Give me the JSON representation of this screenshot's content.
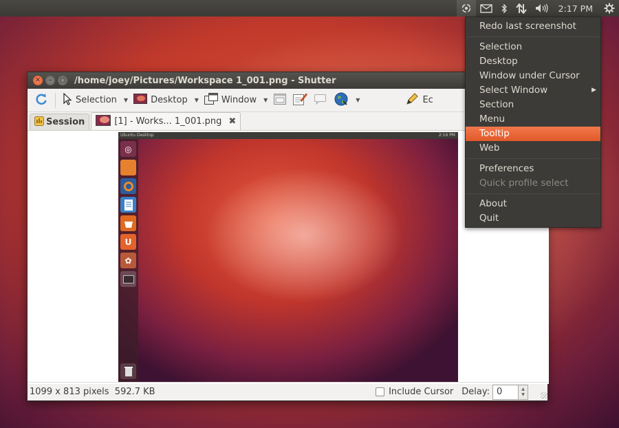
{
  "panel": {
    "clock": "2:17 PM",
    "tray_icons": [
      "shutter-icon",
      "mail-icon",
      "bluetooth-icon",
      "network-icon",
      "volume-icon",
      "gear-icon"
    ]
  },
  "menu": {
    "items": [
      {
        "label": "Redo last screenshot"
      },
      {
        "label": "Selection"
      },
      {
        "label": "Desktop"
      },
      {
        "label": "Window under Cursor"
      },
      {
        "label": "Select Window"
      },
      {
        "label": "Section"
      },
      {
        "label": "Menu"
      },
      {
        "label": "Tooltip"
      },
      {
        "label": "Web"
      },
      {
        "label": "Preferences"
      },
      {
        "label": "Quick profile select"
      },
      {
        "label": "About"
      },
      {
        "label": "Quit"
      }
    ],
    "highlight_color": "#e9643a"
  },
  "window": {
    "title": "/home/joey/Pictures/Workspace 1_001.png - Shutter",
    "toolbar": {
      "selection": "Selection",
      "desktop": "Desktop",
      "window": "Window",
      "edit_partial": "Ec"
    },
    "tabs": {
      "session": "Session",
      "file": "[1] - Works... 1_001.png"
    },
    "preview": {
      "panel_title": "Ubuntu Desktop",
      "panel_clock": "2:16 PM"
    },
    "status": {
      "info": "1099 x 813 pixels  592.7 KB",
      "include_cursor": "Include Cursor",
      "delay_label": "Delay:",
      "delay_value": "0"
    }
  }
}
